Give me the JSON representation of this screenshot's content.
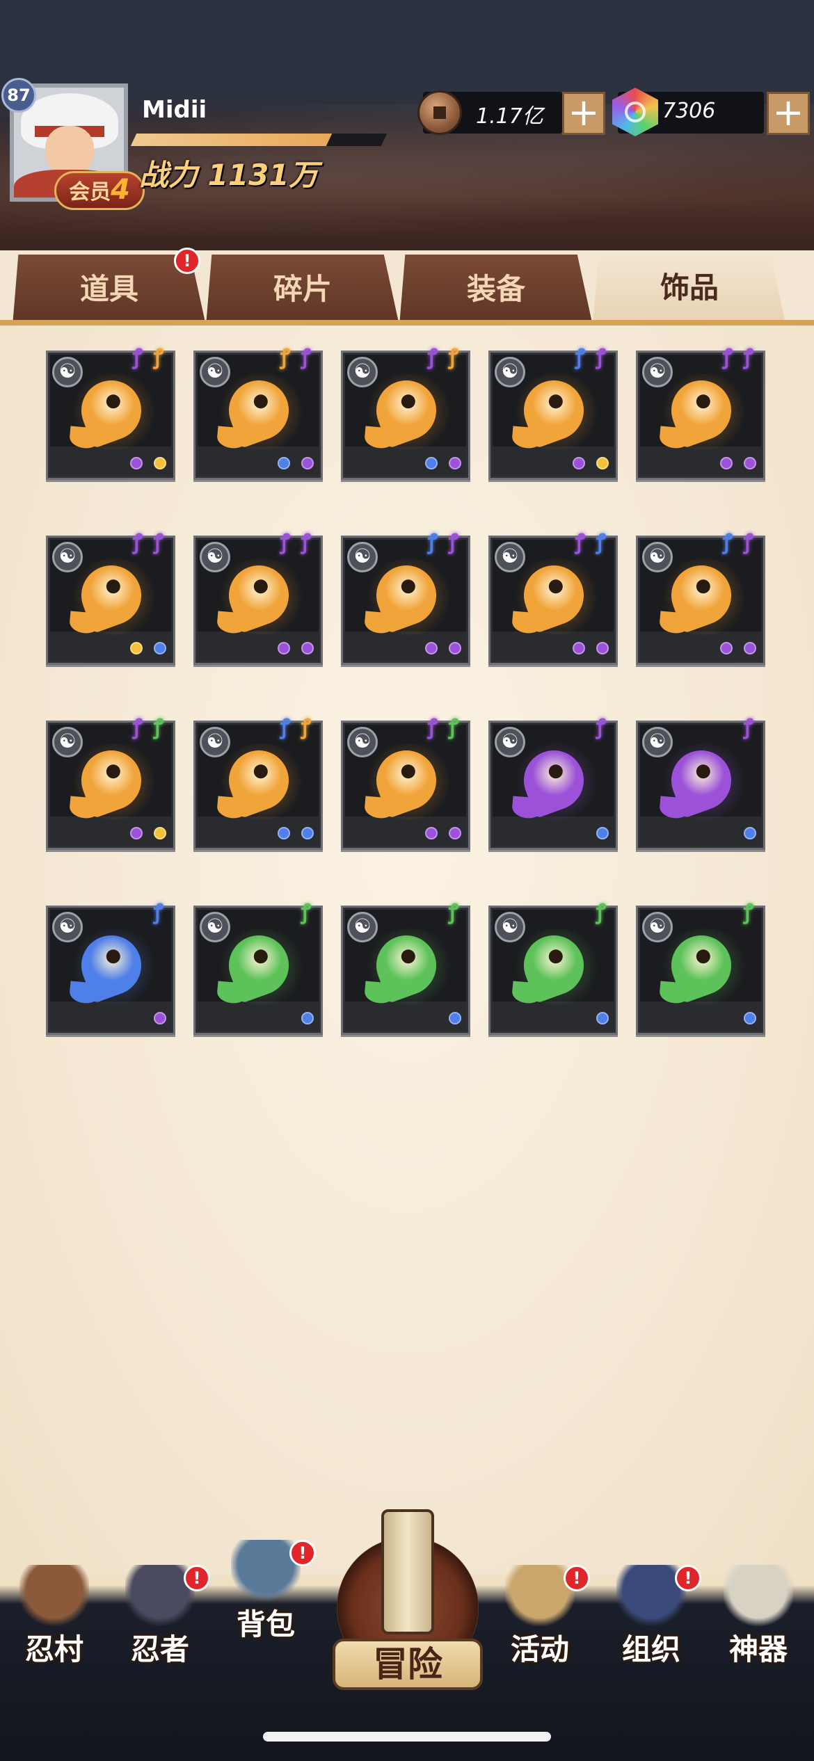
{
  "player": {
    "level": "87",
    "name": "Midii",
    "vip_label": "会员",
    "vip_level": "4",
    "power": "战力 1131万",
    "exp_fraction": 0.78
  },
  "currency": {
    "coins": "1.17亿",
    "gems": "7306",
    "plus": "+"
  },
  "tabs": [
    {
      "label": "道具",
      "active": false,
      "alert": true
    },
    {
      "label": "碎片",
      "active": false,
      "alert": false
    },
    {
      "label": "装备",
      "active": false,
      "alert": false
    },
    {
      "label": "饰品",
      "active": true,
      "alert": false
    }
  ],
  "alert_mark": "!",
  "items": [
    {
      "color": "orange",
      "flames": [
        "purple",
        "orange"
      ],
      "dots": [
        "purple",
        "yellow"
      ]
    },
    {
      "color": "orange",
      "flames": [
        "orange",
        "purple"
      ],
      "dots": [
        "blue",
        "purple"
      ]
    },
    {
      "color": "orange",
      "flames": [
        "purple",
        "orange"
      ],
      "dots": [
        "blue",
        "purple"
      ]
    },
    {
      "color": "orange",
      "flames": [
        "blue",
        "purple"
      ],
      "dots": [
        "purple",
        "yellow"
      ]
    },
    {
      "color": "orange",
      "flames": [
        "purple",
        "purple"
      ],
      "dots": [
        "purple",
        "purple"
      ]
    },
    {
      "color": "orange",
      "flames": [
        "purple",
        "purple"
      ],
      "dots": [
        "yellow",
        "blue"
      ]
    },
    {
      "color": "orange",
      "flames": [
        "purple",
        "purple"
      ],
      "dots": [
        "purple",
        "purple"
      ]
    },
    {
      "color": "orange",
      "flames": [
        "blue",
        "purple"
      ],
      "dots": [
        "purple",
        "purple"
      ]
    },
    {
      "color": "orange",
      "flames": [
        "purple",
        "blue"
      ],
      "dots": [
        "purple",
        "purple"
      ]
    },
    {
      "color": "orange",
      "flames": [
        "blue",
        "purple"
      ],
      "dots": [
        "purple",
        "purple"
      ]
    },
    {
      "color": "orange",
      "flames": [
        "purple",
        "green"
      ],
      "dots": [
        "purple",
        "yellow"
      ]
    },
    {
      "color": "orange",
      "flames": [
        "blue",
        "orange"
      ],
      "dots": [
        "blue",
        "blue"
      ]
    },
    {
      "color": "orange",
      "flames": [
        "purple",
        "green"
      ],
      "dots": [
        "purple",
        "purple"
      ]
    },
    {
      "color": "purple",
      "flames": [
        "purple"
      ],
      "dots": [
        "blue"
      ]
    },
    {
      "color": "purple",
      "flames": [
        "purple"
      ],
      "dots": [
        "blue"
      ]
    },
    {
      "color": "blue",
      "flames": [
        "blue"
      ],
      "dots": [
        "purple"
      ]
    },
    {
      "color": "green",
      "flames": [
        "green"
      ],
      "dots": [
        "blue"
      ]
    },
    {
      "color": "green",
      "flames": [
        "green"
      ],
      "dots": [
        "blue"
      ]
    },
    {
      "color": "green",
      "flames": [
        "green"
      ],
      "dots": [
        "blue"
      ]
    },
    {
      "color": "green",
      "flames": [
        "green"
      ],
      "dots": [
        "blue"
      ]
    }
  ],
  "nav": [
    {
      "label": "忍村",
      "icon": "village-gate-icon",
      "alert": false
    },
    {
      "label": "忍者",
      "icon": "ninja-head-icon",
      "alert": true
    },
    {
      "label": "背包",
      "icon": "backpack-icon",
      "alert": true
    },
    {
      "label": "冒险",
      "icon": "adventure-scroll-icon",
      "alert": false
    },
    {
      "label": "活动",
      "icon": "activity-drum-icon",
      "alert": true
    },
    {
      "label": "组织",
      "icon": "organization-ninja-icon",
      "alert": true
    },
    {
      "label": "神器",
      "icon": "artifact-scroll-icon",
      "alert": false
    }
  ],
  "colors": {
    "orange": "#f1a43a",
    "purple": "#9b52d8",
    "blue": "#4f7fe8",
    "green": "#5ec25a",
    "yellow": "#f3c23a",
    "tab_active_text": "#4b2a1e",
    "alert_red": "#e0262a"
  }
}
